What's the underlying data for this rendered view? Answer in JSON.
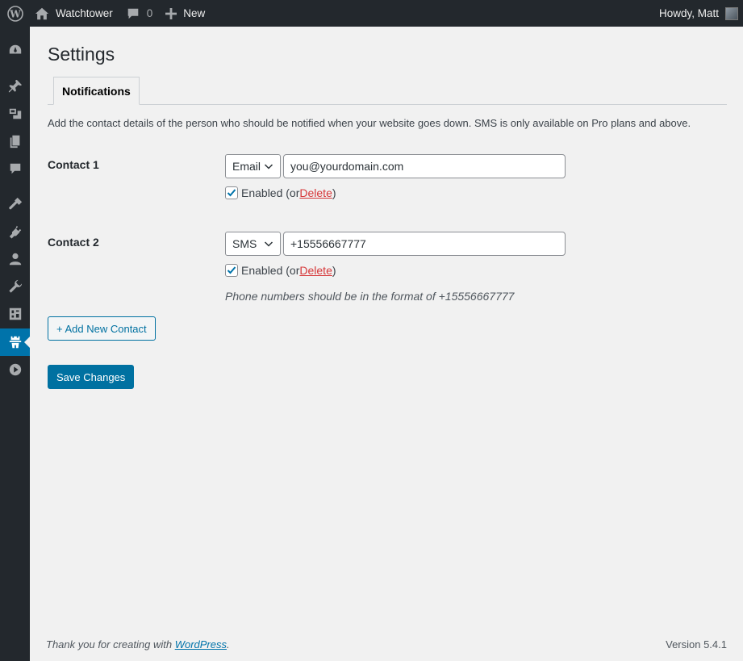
{
  "adminbar": {
    "site_name": "Watchtower",
    "comments_count": "0",
    "new_label": "New",
    "howdy": "Howdy, Matt"
  },
  "sidemenu": {
    "icons": [
      "dashboard-icon",
      "posts-pin-icon",
      "media-icon",
      "pages-icon",
      "comments-icon",
      "appearance-icon",
      "plugins-icon",
      "users-icon",
      "tools-icon",
      "settings-icon",
      "watchtower-icon",
      "play-icon"
    ],
    "current": "watchtower-icon"
  },
  "page": {
    "title": "Settings",
    "tab": "Notifications",
    "intro": "Add the contact details of the person who should be notified when your website goes down. SMS is only available on Pro plans and above."
  },
  "contacts": [
    {
      "label": "Contact 1",
      "type": "Email",
      "value": "you@yourdomain.com",
      "enabled": true,
      "enabled_text": "Enabled (or ",
      "delete_text": "Delete",
      "close_paren": ")"
    },
    {
      "label": "Contact 2",
      "type": "SMS",
      "value": "+15556667777",
      "enabled": true,
      "enabled_text": "Enabled (or ",
      "delete_text": "Delete",
      "close_paren": ")"
    }
  ],
  "help_text": "Phone numbers should be in the format of +15556667777",
  "buttons": {
    "add_contact": "+ Add New Contact",
    "save": "Save Changes"
  },
  "footer": {
    "thanks_prefix": "Thank you for creating with ",
    "wordpress_link": "WordPress",
    "thanks_suffix": ".",
    "version": "Version 5.4.1"
  },
  "colors": {
    "accent": "#0073aa",
    "adminbar": "#23282d",
    "delete": "#d63638"
  }
}
